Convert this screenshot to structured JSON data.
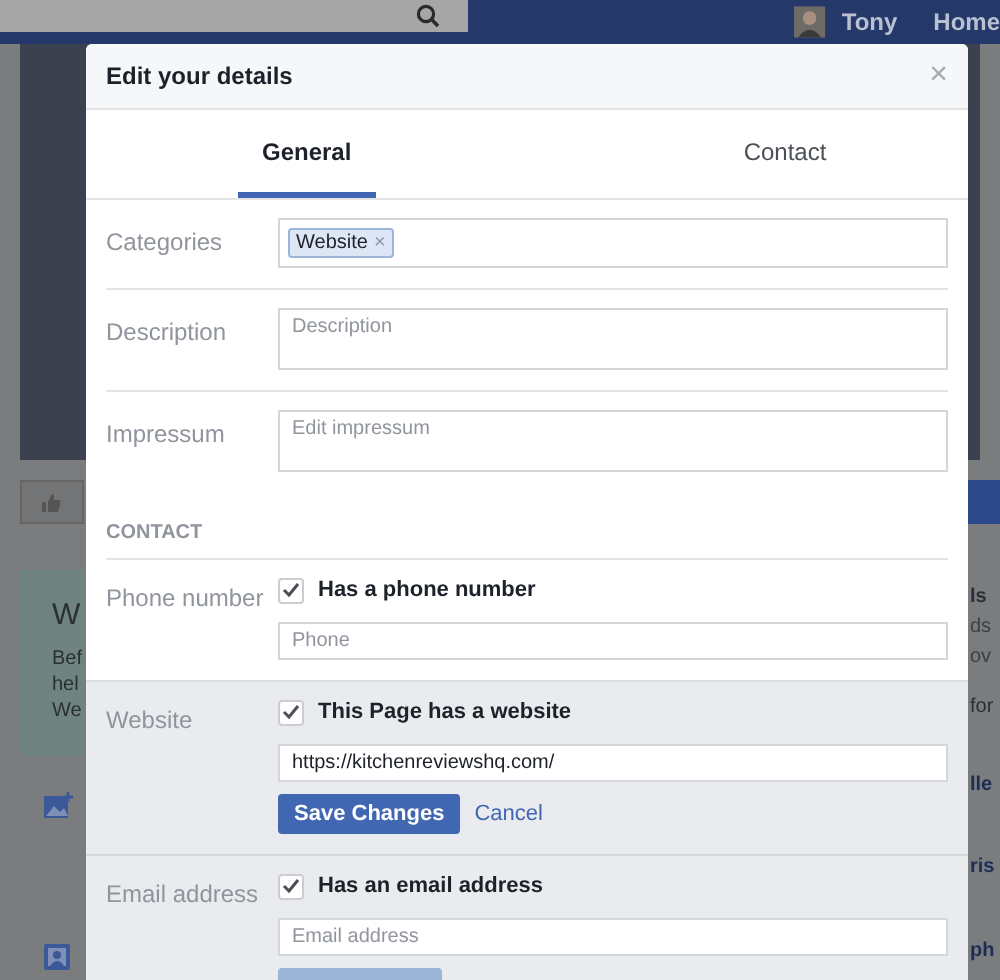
{
  "topbar": {
    "user": "Tony",
    "nav": [
      "Home"
    ]
  },
  "background": {
    "left_texts": [
      "W",
      "Bef",
      "hel",
      "We"
    ],
    "right_texts": [
      "ls",
      "ds",
      "ov",
      "for",
      "lle",
      "ris",
      "ph"
    ]
  },
  "dialog": {
    "title": "Edit your details",
    "close": "×",
    "tabs": [
      {
        "label": "General",
        "selected": true
      },
      {
        "label": "Contact",
        "selected": false
      }
    ],
    "fields": [
      {
        "label": "Categories",
        "kind": "tags",
        "tags": [
          {
            "text": "Website",
            "remove": "×"
          }
        ]
      },
      {
        "label": "Description",
        "kind": "textarea",
        "placeholder": "Description"
      },
      {
        "label": "Impressum",
        "kind": "textarea",
        "placeholder": "Edit impressum"
      }
    ],
    "section_heading": "CONTACT",
    "contact": [
      {
        "label": "Phone number",
        "checkbox": "Has a phone number",
        "checked": true,
        "placeholder": "Phone",
        "editing": false
      },
      {
        "label": "Website",
        "checkbox": "This Page has a website",
        "checked": true,
        "value": "https://kitchenreviewshq.com/",
        "editing": true,
        "save": "Save Changes",
        "save_disabled": false,
        "cancel": "Cancel"
      },
      {
        "label": "Email address",
        "checkbox": "Has an email address",
        "checked": true,
        "placeholder": "Email address",
        "editing": true,
        "save_disabled": true
      }
    ]
  }
}
